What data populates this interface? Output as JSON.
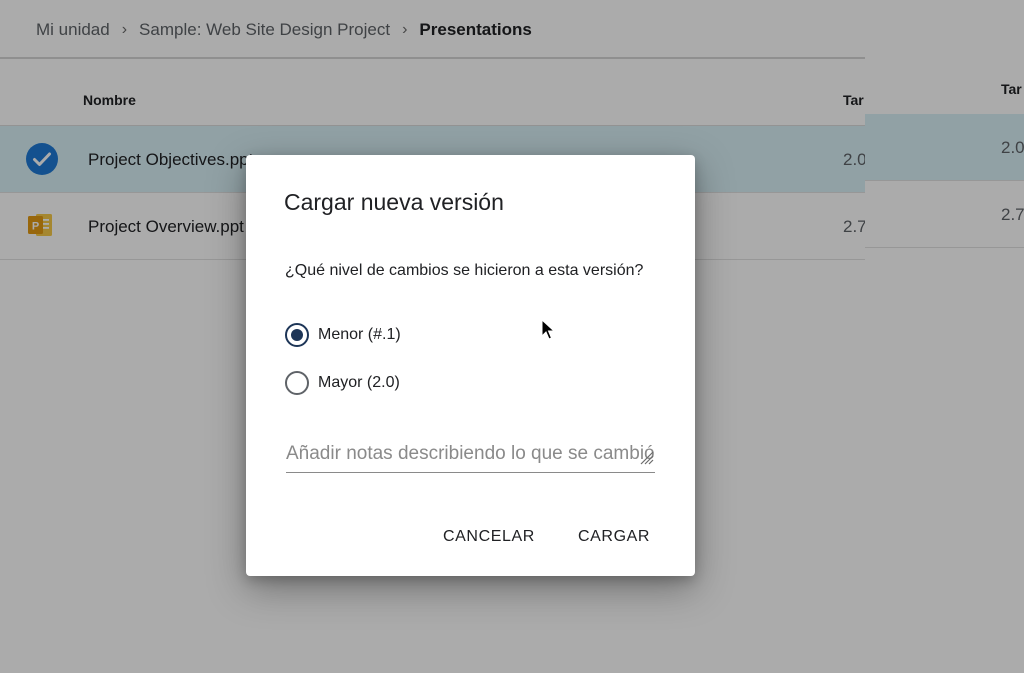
{
  "breadcrumb": {
    "items": [
      "Mi unidad",
      "Sample: Web Site Design Project",
      "Presentations"
    ],
    "separator": "›"
  },
  "file_list": {
    "columns": {
      "name": "Nombre",
      "size": "Tar"
    },
    "rows": [
      {
        "name": "Project Objectives.ppt",
        "size": "2.0",
        "selected": true,
        "icon": "checkmark-circle-icon"
      },
      {
        "name": "Project Overview.ppt",
        "size": "2.7",
        "selected": false,
        "icon": "powerpoint-icon"
      }
    ]
  },
  "right_pane": {
    "header": "Tar",
    "sizes": [
      "2.0",
      "2.7"
    ]
  },
  "dialog": {
    "title": "Cargar nueva versión",
    "question": "¿Qué nivel de cambios se hicieron a esta versión?",
    "options": [
      {
        "label": "Menor (#.1)",
        "checked": true
      },
      {
        "label": "Mayor (2.0)",
        "checked": false
      }
    ],
    "notes_placeholder": "Añadir notas describiendo lo que se cambió",
    "cancel_label": "CANCELAR",
    "upload_label": "CARGAR"
  },
  "colors": {
    "selected_row": "#d9f0f7",
    "check_blue": "#1e7ad6",
    "radio_checked": "#1d3557",
    "ppt_orange": "#f0b429"
  }
}
